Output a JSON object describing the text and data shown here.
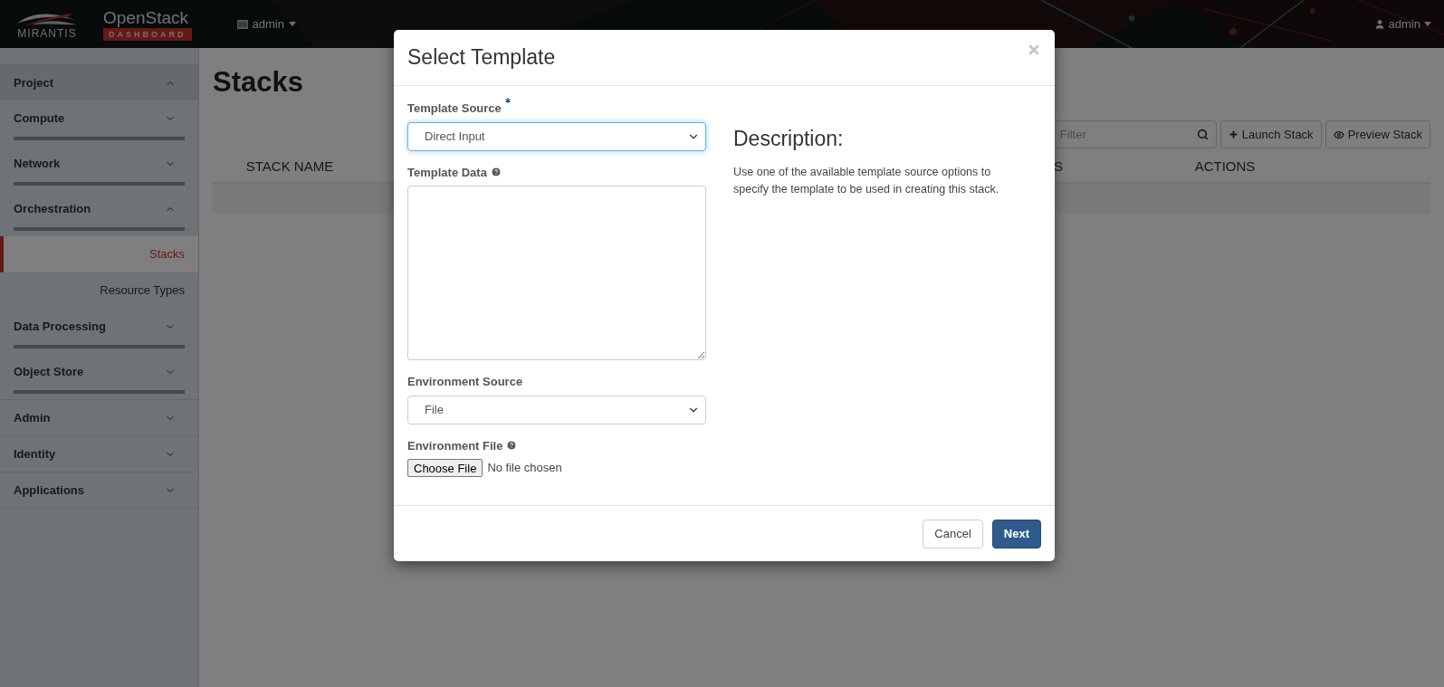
{
  "header": {
    "brand": {
      "company": "MIRANTIS",
      "product": "OpenStack",
      "subtitle": "DASHBOARD"
    },
    "project_menu": "admin",
    "user_menu": "admin"
  },
  "sidebar": {
    "items": [
      {
        "label": "Project",
        "expanded": true,
        "children": [
          {
            "label": "Compute",
            "expanded": false
          },
          {
            "label": "Network",
            "expanded": false
          },
          {
            "label": "Orchestration",
            "expanded": true,
            "children": [
              {
                "label": "Stacks",
                "selected": true
              },
              {
                "label": "Resource Types",
                "selected": false
              }
            ]
          },
          {
            "label": "Data Processing",
            "expanded": false
          },
          {
            "label": "Object Store",
            "expanded": false
          }
        ]
      },
      {
        "label": "Admin",
        "expanded": false
      },
      {
        "label": "Identity",
        "expanded": false
      },
      {
        "label": "Applications",
        "expanded": false
      }
    ]
  },
  "page": {
    "title": "Stacks",
    "filter": {
      "placeholder": "Filter"
    },
    "buttons": [
      {
        "label": "Launch Stack",
        "kind": "add"
      },
      {
        "label": "Preview Stack",
        "kind": "preview"
      }
    ],
    "table": {
      "columns": [
        "STACK NAME",
        "S",
        "ACTIONS"
      ]
    }
  },
  "modal": {
    "title": "Select Template",
    "fields": [
      {
        "kind": "select",
        "label": "Template Source",
        "required": true,
        "help": false,
        "value": "Direct Input",
        "focused": true
      },
      {
        "kind": "textarea",
        "label": "Template Data",
        "required": false,
        "help": true
      },
      {
        "kind": "select",
        "label": "Environment Source",
        "required": false,
        "help": false,
        "value": "File",
        "focused": false
      },
      {
        "kind": "file",
        "label": "Environment File",
        "required": false,
        "help": true,
        "button": "Choose File",
        "status": "No file chosen"
      }
    ],
    "description": {
      "heading": "Description:",
      "text": "Use one of the available template source options to specify the template to be used in creating this stack."
    },
    "buttons": [
      {
        "label": "Cancel",
        "primary": false
      },
      {
        "label": "Next",
        "primary": true
      }
    ]
  }
}
